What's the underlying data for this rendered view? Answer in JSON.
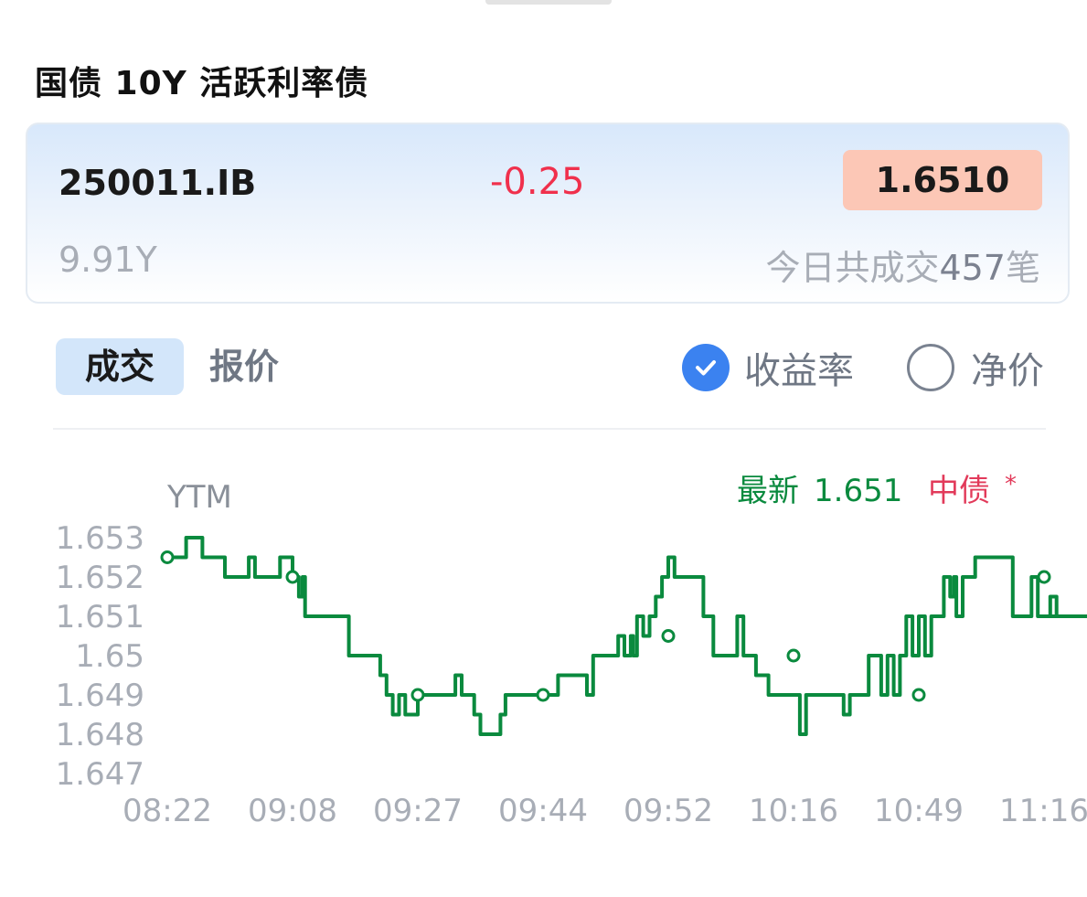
{
  "title": "国债 10Y 活跃利率债",
  "bond": {
    "code": "250011.IB",
    "change": "-0.25",
    "price": "1.6510",
    "maturity": "9.91Y",
    "trades_prefix": "今日共成交",
    "trades_count": "457",
    "trades_suffix": "笔"
  },
  "tabs": {
    "trade": "成交",
    "quote": "报价"
  },
  "options": {
    "yield": "收益率",
    "yield_checked": true,
    "net_price": "净价",
    "net_price_checked": false
  },
  "icons": {
    "yield_radio": "checkmark-icon",
    "net_radio": "radio-empty-icon"
  },
  "colors": {
    "line": "#0a8a3e",
    "change": "#f0304c",
    "price_bg": "#fcc7b6",
    "zhongzhai": "#e23a5a",
    "accent": "#3b82f0"
  },
  "chart_data": {
    "type": "line",
    "ylabel": "YTM",
    "legend_latest_label": "最新",
    "legend_latest_value": "1.651",
    "legend_ref": "中债",
    "legend_ref_star": "*",
    "yticks": [
      "1.653",
      "1.652",
      "1.651",
      "1.65",
      "1.649",
      "1.648",
      "1.647"
    ],
    "ylim": [
      1.647,
      1.653
    ],
    "xticks": [
      "08:22",
      "09:08",
      "09:27",
      "09:44",
      "09:52",
      "10:16",
      "10:49",
      "11:16"
    ],
    "x": [
      0.0,
      0.08,
      0.15,
      0.2,
      0.28,
      0.4,
      0.46,
      0.6,
      0.65,
      0.7,
      0.82,
      0.9,
      0.95,
      1.0,
      1.02,
      1.05,
      1.08,
      1.1,
      1.18,
      1.22,
      1.24,
      1.27,
      1.3,
      1.32,
      1.36,
      1.45,
      1.48,
      1.55,
      1.56,
      1.6,
      1.65,
      1.7,
      1.75,
      1.8,
      1.85,
      1.9,
      1.95,
      2.0,
      2.05,
      2.15,
      2.3,
      2.35,
      2.4,
      2.45,
      2.5,
      2.55,
      2.58,
      2.62,
      2.66,
      2.7,
      2.74,
      2.78,
      2.8,
      2.85,
      2.9,
      3.0,
      3.1,
      3.12,
      3.2,
      3.3,
      3.35,
      3.4,
      3.45,
      3.5,
      3.55,
      3.6,
      3.65,
      3.7,
      3.72,
      3.75,
      3.8,
      3.85,
      3.9,
      3.95,
      4.0,
      4.02,
      4.05,
      4.1,
      4.15,
      4.2,
      4.25,
      4.28,
      4.32,
      4.36,
      4.4,
      4.45,
      4.5,
      4.55,
      4.6,
      4.65,
      4.68,
      4.7,
      4.75,
      4.8,
      4.85,
      4.9,
      5.0,
      5.05,
      5.1,
      5.15,
      5.2,
      5.22,
      5.25,
      5.3,
      5.35,
      5.4,
      5.45,
      5.5,
      5.55,
      5.6,
      5.65,
      5.7,
      5.75,
      5.8,
      5.85,
      5.9,
      5.95,
      6.0,
      6.05,
      6.1,
      6.15,
      6.2,
      6.25,
      6.28,
      6.3,
      6.35,
      6.4,
      6.45,
      6.5,
      6.55,
      6.6,
      6.65,
      6.7,
      6.75,
      6.8,
      6.85,
      6.9,
      6.95,
      7.0,
      7.05,
      7.1,
      7.15,
      7.2,
      7.25,
      7.3,
      7.35
    ],
    "y": [
      1.6525,
      1.6525,
      1.653,
      1.653,
      1.6525,
      1.6525,
      1.652,
      1.652,
      1.6525,
      1.652,
      1.652,
      1.6525,
      1.6525,
      1.652,
      1.652,
      1.6515,
      1.652,
      1.651,
      1.651,
      1.651,
      1.651,
      1.651,
      1.651,
      1.651,
      1.651,
      1.65,
      1.65,
      1.65,
      1.65,
      1.65,
      1.65,
      1.6495,
      1.649,
      1.6485,
      1.649,
      1.6485,
      1.6485,
      1.649,
      1.649,
      1.649,
      1.6495,
      1.649,
      1.649,
      1.6485,
      1.648,
      1.648,
      1.648,
      1.648,
      1.6485,
      1.649,
      1.649,
      1.649,
      1.649,
      1.649,
      1.649,
      1.649,
      1.649,
      1.6495,
      1.6495,
      1.6495,
      1.649,
      1.65,
      1.65,
      1.65,
      1.65,
      1.6505,
      1.65,
      1.6505,
      1.65,
      1.651,
      1.6505,
      1.651,
      1.6515,
      1.652,
      1.6525,
      1.6525,
      1.652,
      1.652,
      1.652,
      1.652,
      1.652,
      1.651,
      1.651,
      1.65,
      1.65,
      1.65,
      1.65,
      1.651,
      1.65,
      1.65,
      1.65,
      1.6495,
      1.6495,
      1.649,
      1.649,
      1.649,
      1.649,
      1.648,
      1.649,
      1.649,
      1.649,
      1.649,
      1.649,
      1.649,
      1.649,
      1.6485,
      1.649,
      1.649,
      1.649,
      1.65,
      1.65,
      1.649,
      1.65,
      1.649,
      1.65,
      1.651,
      1.65,
      1.651,
      1.65,
      1.651,
      1.651,
      1.652,
      1.6515,
      1.652,
      1.651,
      1.652,
      1.652,
      1.6525,
      1.6525,
      1.6525,
      1.6525,
      1.6525,
      1.6525,
      1.651,
      1.651,
      1.651,
      1.652,
      1.651,
      1.651,
      1.6515,
      1.651,
      1.651,
      1.651,
      1.651,
      1.651,
      1.651,
      1.651
    ],
    "markers_x": [
      0.0,
      1.0,
      2.0,
      3.0,
      4.0,
      5.0,
      6.0,
      7.0
    ],
    "markers_y": [
      1.6525,
      1.652,
      1.649,
      1.649,
      1.6505,
      1.65,
      1.649,
      1.652
    ]
  }
}
